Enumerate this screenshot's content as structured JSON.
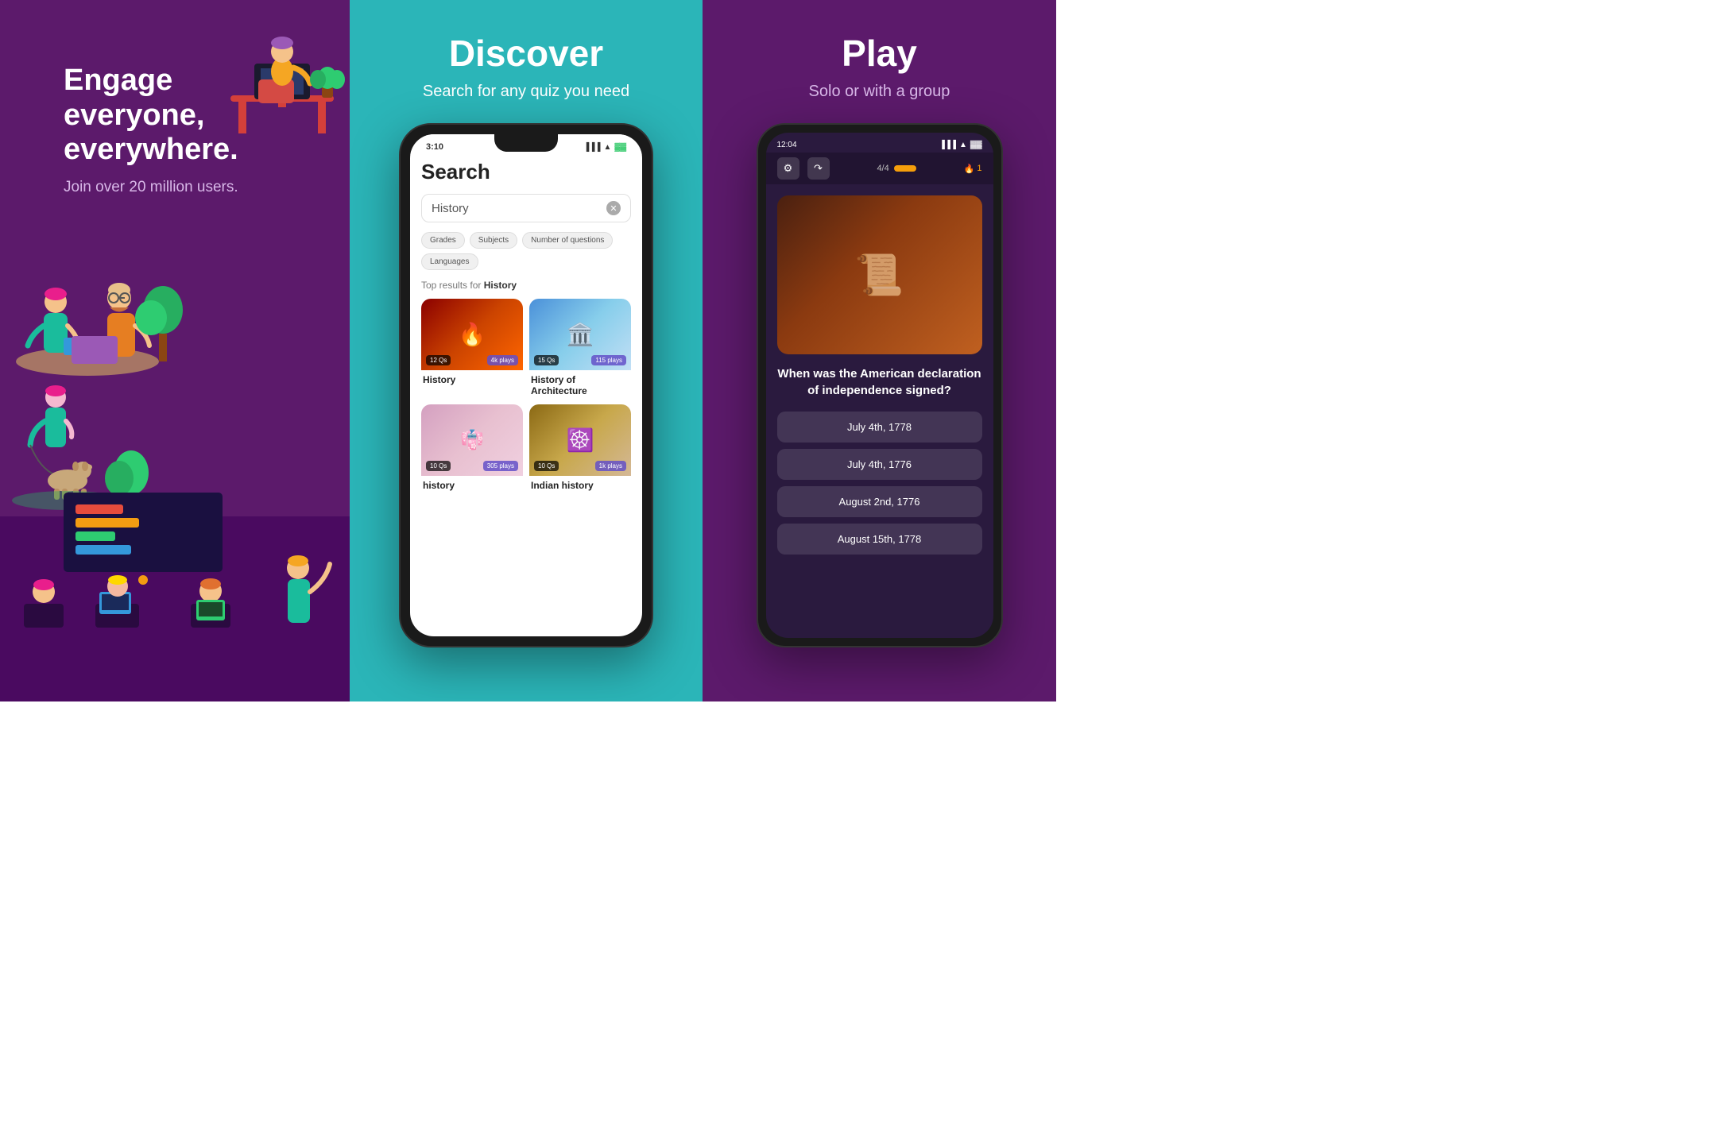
{
  "panel1": {
    "headline": "Engage everyone, everywhere.",
    "subtext": "Join over 20 million users."
  },
  "panel2": {
    "title": "Discover",
    "subtitle": "Search for any quiz you need",
    "phone": {
      "time": "3:10",
      "search_placeholder": "History",
      "filters": [
        "Grades",
        "Subjects",
        "Number of questions",
        "Languages"
      ],
      "results_prefix": "Top results for",
      "results_keyword": "History",
      "cards": [
        {
          "title": "History",
          "qs": "12 Qs",
          "plays": "4k plays",
          "img_type": "history"
        },
        {
          "title": "History of Architecture",
          "qs": "15 Qs",
          "plays": "115 plays",
          "img_type": "arch"
        },
        {
          "title": "history",
          "qs": "10 Qs",
          "plays": "305 plays",
          "img_type": "history-play"
        },
        {
          "title": "Indian history",
          "qs": "10 Qs",
          "plays": "1k plays",
          "img_type": "indian"
        }
      ]
    }
  },
  "panel3": {
    "title": "Play",
    "subtitle": "Solo or with a group",
    "phone": {
      "time": "12:04",
      "progress": "4/4",
      "streak": "1",
      "question": "When was the American declaration of independence signed?",
      "answers": [
        "July 4th, 1778",
        "July 4th, 1776",
        "August 2nd, 1776",
        "August 15th, 1778"
      ]
    }
  }
}
